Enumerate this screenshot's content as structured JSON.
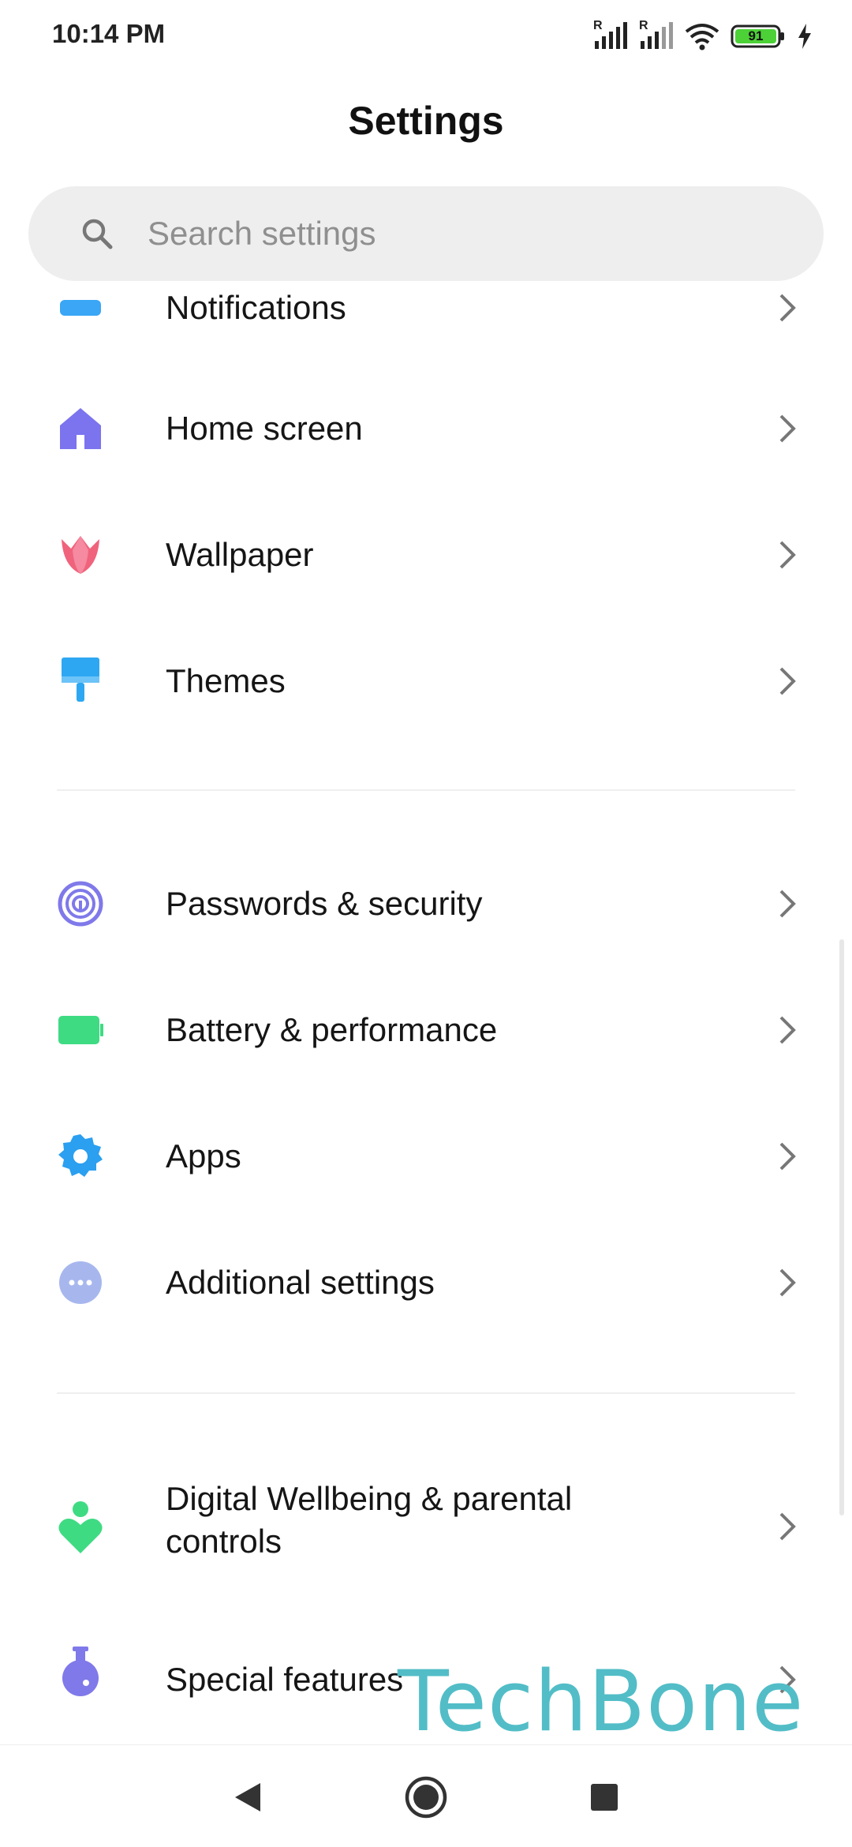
{
  "status_bar": {
    "time": "10:14 PM",
    "roaming_label_1": "R",
    "roaming_label_2": "R",
    "battery_percent": "91"
  },
  "header": {
    "title": "Settings"
  },
  "search": {
    "placeholder": "Search settings"
  },
  "sections": [
    {
      "items": [
        {
          "label": "Notifications",
          "icon": "notifications-icon",
          "color": "#3aa6f5"
        },
        {
          "label": "Home screen",
          "icon": "home-icon",
          "color": "#7b74ee"
        },
        {
          "label": "Wallpaper",
          "icon": "tulip-icon",
          "color": "#f0637c"
        },
        {
          "label": "Themes",
          "icon": "paint-roller-icon",
          "color": "#2ea7f2"
        }
      ]
    },
    {
      "items": [
        {
          "label": "Passwords & security",
          "icon": "fingerprint-icon",
          "color": "#7f79ea"
        },
        {
          "label": "Battery & performance",
          "icon": "battery-icon",
          "color": "#3fdb83"
        },
        {
          "label": "Apps",
          "icon": "gear-icon",
          "color": "#2b9ff0"
        },
        {
          "label": "Additional settings",
          "icon": "more-dots-icon",
          "color": "#a7b7ee"
        }
      ]
    },
    {
      "items": [
        {
          "label_line1": "Digital Wellbeing & parental",
          "label_line2": "controls",
          "icon": "wellbeing-heart-icon",
          "color": "#3fdb83"
        },
        {
          "label": "Special features",
          "icon": "flask-icon",
          "color": "#7f79ea"
        }
      ]
    }
  ],
  "watermark": "TechBone",
  "nav_bar": {
    "buttons": [
      "back-icon",
      "home-circle-icon",
      "recents-icon"
    ]
  }
}
